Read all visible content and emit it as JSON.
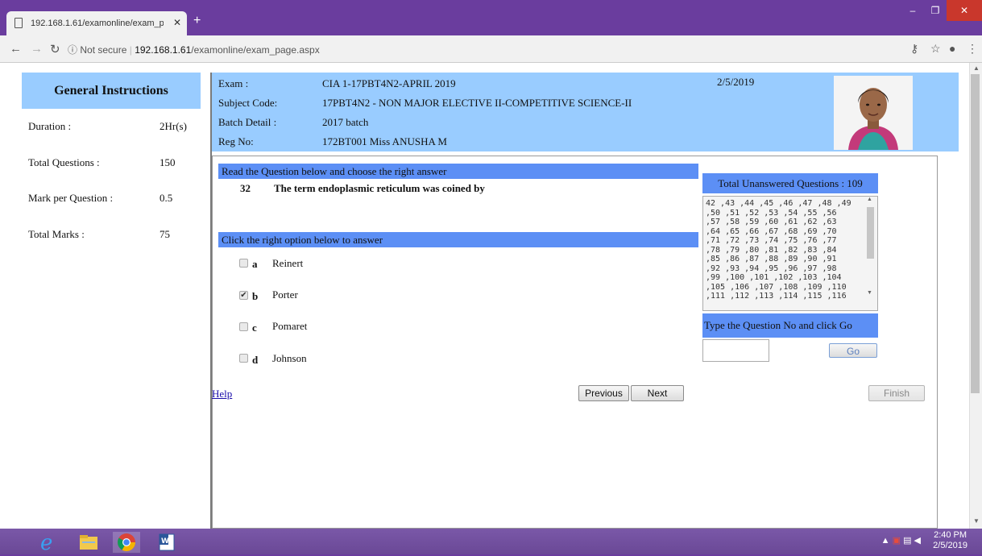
{
  "browser": {
    "tab_title": "192.168.1.61/examonline/exam_p",
    "security_label": "Not secure",
    "url_host": "192.168.1.61",
    "url_path": "/examonline/exam_page.aspx"
  },
  "instructions": {
    "header": "General Instructions",
    "items": [
      {
        "label": "Duration :",
        "value": "2Hr(s)"
      },
      {
        "label": "Total Questions :",
        "value": "150"
      },
      {
        "label": "Mark per Question :",
        "value": "0.5"
      },
      {
        "label": "Total Marks :",
        "value": "75"
      }
    ]
  },
  "exam_info": {
    "exam_label": "Exam :",
    "exam_value": "CIA 1-17PBT4N2-APRIL 2019",
    "subject_label": "Subject Code:",
    "subject_value": "17PBT4N2 - NON MAJOR ELECTIVE II-COMPETITIVE SCIENCE-II",
    "batch_label": "Batch Detail :",
    "batch_value": "2017 batch",
    "reg_label": "Reg No:",
    "reg_value": "172BT001 Miss ANUSHA M",
    "date": "2/5/2019"
  },
  "question": {
    "instruction": "Read the Question below and choose the right answer",
    "number": "32",
    "text": "The term endoplasmic reticulum was coined by",
    "options_header": "Click the right option below to answer",
    "options": [
      {
        "letter": "a",
        "text": "Reinert",
        "checked": false
      },
      {
        "letter": "b",
        "text": "Porter",
        "checked": true
      },
      {
        "letter": "c",
        "text": "Pomaret",
        "checked": false
      },
      {
        "letter": "d",
        "text": "Johnson",
        "checked": false
      }
    ]
  },
  "navigation": {
    "help": "Help",
    "previous": "Previous",
    "next": "Next",
    "finish": "Finish"
  },
  "unanswered": {
    "header": "Total Unanswered Questions : 109",
    "list": "42 ,43 ,44 ,45 ,46 ,47 ,48 ,49\n,50 ,51 ,52 ,53 ,54 ,55 ,56\n,57 ,58 ,59 ,60 ,61 ,62 ,63\n,64 ,65 ,66 ,67 ,68 ,69 ,70\n,71 ,72 ,73 ,74 ,75 ,76 ,77\n,78 ,79 ,80 ,81 ,82 ,83 ,84\n,85 ,86 ,87 ,88 ,89 ,90 ,91\n,92 ,93 ,94 ,95 ,96 ,97 ,98\n,99 ,100 ,101 ,102 ,103 ,104\n,105 ,106 ,107 ,108 ,109 ,110\n,111 ,112 ,113 ,114 ,115 ,116",
    "goto_label": "Type the Question No and click Go",
    "go_button": "Go"
  },
  "taskbar": {
    "time": "2:40 PM",
    "date": "2/5/2019"
  },
  "colors": {
    "header_band": "#99ccff",
    "accent_band": "#5c8ff5",
    "window_frame": "#6a3d9e"
  }
}
